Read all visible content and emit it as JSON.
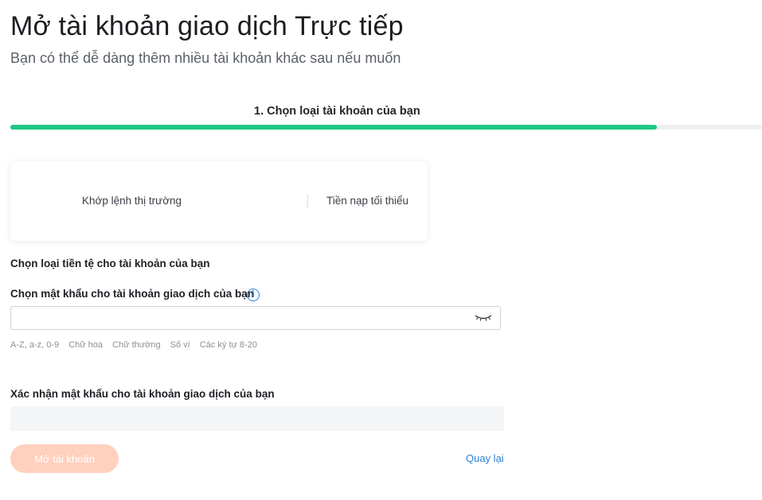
{
  "header": {
    "title": "Mở tài khoản giao dịch Trực tiếp",
    "subtitle": "Bạn có thể dễ dàng thêm nhiều tài khoản khác sau nếu muốn"
  },
  "progress": {
    "step_label": "1. Chọn loại tài khoản của bạn",
    "fraction": 0.86,
    "color": "#20c784"
  },
  "account_card": {
    "execution_label": "Khớp lệnh thị trường",
    "min_deposit_label": "Tiền nạp tối thiểu"
  },
  "form": {
    "currency_label": "Chọn loại tiền tệ cho tài khoản của bạn",
    "password_label": "Chọn mật khẩu cho tài khoản giao dịch của bạn",
    "info_icon": "info-icon",
    "password_value": "",
    "eye_icon": "eye-closed-icon",
    "password_rules": [
      "A-Z, a-z, 0-9",
      "Chữ hoa",
      "Chữ thường",
      "Số ví",
      "Các ký tự 8-20"
    ],
    "confirm_label": "Xác nhận mật khẩu cho tài khoản giao dịch của bạn",
    "confirm_value": ""
  },
  "actions": {
    "open_account_label": "Mở tài khoản",
    "open_account_color": "#ffd0bd",
    "back_label": "Quay lại",
    "link_color": "#2e7fd6"
  }
}
